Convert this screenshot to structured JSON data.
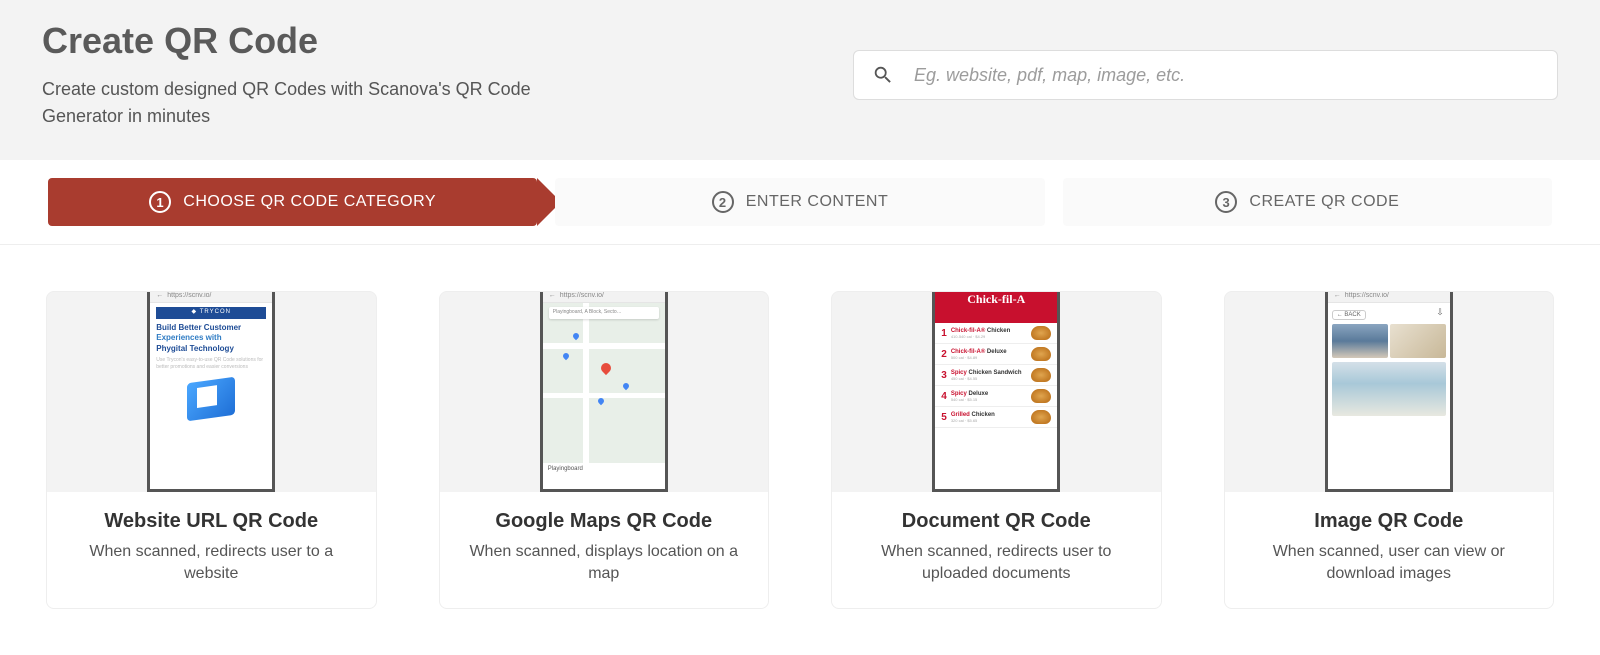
{
  "header": {
    "title": "Create QR Code",
    "subtitle": "Create custom designed QR Codes with Scanova's QR Code Generator in minutes"
  },
  "search": {
    "placeholder": "Eg. website, pdf, map, image, etc."
  },
  "steps": [
    {
      "num": "1",
      "label": "CHOOSE QR CODE CATEGORY",
      "active": true
    },
    {
      "num": "2",
      "label": "ENTER CONTENT",
      "active": false
    },
    {
      "num": "3",
      "label": "CREATE QR CODE",
      "active": false
    }
  ],
  "url_sample": "https://scnv.io/",
  "cards": {
    "website": {
      "title": "Website URL QR Code",
      "desc": "When scanned, redirects user to a website",
      "brand": "◆ TRYCON",
      "line1": "Build Better Customer",
      "line2": "Experiences with",
      "line3": "Phygital Technology"
    },
    "maps": {
      "title": "Google Maps QR Code",
      "desc": "When scanned, displays location on a map",
      "search_text": "Playingboard, A Block, Secto…",
      "caption": "Playingboard"
    },
    "document": {
      "title": "Document QR Code",
      "desc": "When scanned, redirects user to uploaded documents",
      "brand": "Chick-fil-A",
      "items": [
        {
          "n": "1",
          "t": "Chick-fil-A® Chicken"
        },
        {
          "n": "2",
          "t": "Chick-fil-A® Deluxe"
        },
        {
          "n": "3",
          "t": "Spicy Chicken Sandwich"
        },
        {
          "n": "4",
          "t": "Spicy Deluxe"
        },
        {
          "n": "5",
          "t": "Grilled Chicken"
        }
      ]
    },
    "image": {
      "title": "Image QR Code",
      "desc": "When scanned, user can view or download images",
      "back": "← BACK"
    }
  }
}
